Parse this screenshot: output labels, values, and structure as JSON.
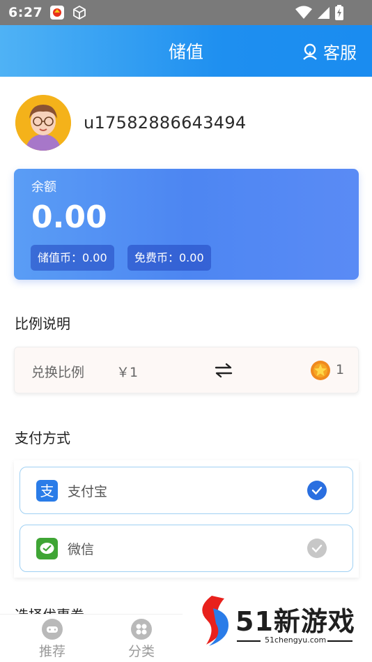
{
  "status_bar": {
    "time": "6:27"
  },
  "header": {
    "title": "储值",
    "customer_service": "客服"
  },
  "profile": {
    "username": "u17582886643494"
  },
  "balance": {
    "label": "余额",
    "amount": "0.00",
    "stored_coin": "储值币：0.00",
    "free_coin": "免费币：0.00"
  },
  "ratio": {
    "section_title": "比例说明",
    "label": "兑换比例",
    "price": "￥1",
    "coin_amount": "1"
  },
  "payment": {
    "section_title": "支付方式",
    "methods": [
      {
        "label": "支付宝",
        "selected": true,
        "color": "#2a7ce8"
      },
      {
        "label": "微信",
        "selected": false,
        "color": "#3fa535"
      }
    ]
  },
  "next_section": {
    "title": "选择优惠券"
  },
  "bottom_nav": [
    {
      "label": "推荐",
      "icon": "gamepad-icon"
    },
    {
      "label": "分类",
      "icon": "grid-icon"
    }
  ],
  "watermark": {
    "text": "51新游戏",
    "subtext": "51chengyu.com"
  },
  "colors": {
    "header": "#1e8ff0",
    "balance_card": "#4d86f2",
    "accent": "#2a7ce8"
  }
}
